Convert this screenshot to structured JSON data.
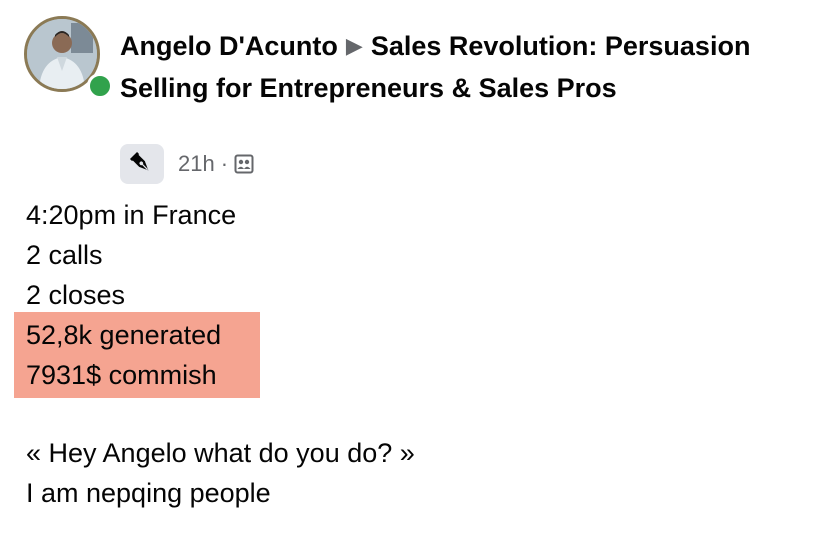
{
  "post": {
    "author": "Angelo D'Acunto",
    "group": "Sales Revolution: Persuasion Selling for Entrepreneurs & Sales Pros",
    "timestamp": "21h",
    "separator": "·",
    "separator_arrow": "▶"
  },
  "body": {
    "lines": [
      "4:20pm in France",
      "2 calls",
      "2 closes",
      "52,8k generated",
      "7931$ commish"
    ],
    "lines2": [
      "« Hey Angelo what do you do? »",
      "I am nepqing people"
    ]
  },
  "colors": {
    "highlight": "#f5a491",
    "online": "#31a24c",
    "meta_text": "#65676b"
  },
  "icons": {
    "badge": "pen-nib-icon",
    "audience": "group-audience-icon"
  }
}
